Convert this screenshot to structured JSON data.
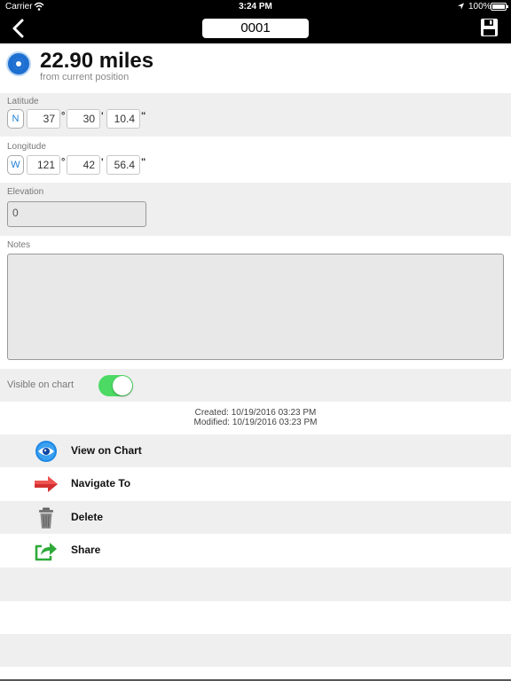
{
  "status_bar": {
    "carrier": "Carrier",
    "time": "3:24 PM",
    "battery": "100%"
  },
  "nav": {
    "title_value": "0001"
  },
  "distance": {
    "value": "22.90 miles",
    "subtitle": "from current position"
  },
  "latitude": {
    "label": "Latitude",
    "hemisphere": "N",
    "degrees": "37",
    "minutes": "30",
    "seconds": "10.4",
    "deg_sym": "°",
    "min_sym": "'",
    "sec_sym": "\""
  },
  "longitude": {
    "label": "Longitude",
    "hemisphere": "W",
    "degrees": "121",
    "minutes": "42",
    "seconds": "56.4",
    "deg_sym": "°",
    "min_sym": "'",
    "sec_sym": "\""
  },
  "elevation": {
    "label": "Elevation",
    "value": "0"
  },
  "notes": {
    "label": "Notes",
    "value": ""
  },
  "visible": {
    "label": "Visible on chart",
    "on": true
  },
  "dates": {
    "created": "Created: 10/19/2016 03:23 PM",
    "modified": "Modified: 10/19/2016 03:23 PM"
  },
  "actions": [
    {
      "label": "View on Chart",
      "icon": "eye-icon"
    },
    {
      "label": "Navigate To",
      "icon": "red-arrow-icon"
    },
    {
      "label": "Delete",
      "icon": "trash-icon"
    },
    {
      "label": "Share",
      "icon": "share-icon"
    }
  ],
  "colors": {
    "toggle_on": "#4cd964",
    "hemisphere_text": "#1e7fd6",
    "target_blue": "#1d6fd1"
  }
}
